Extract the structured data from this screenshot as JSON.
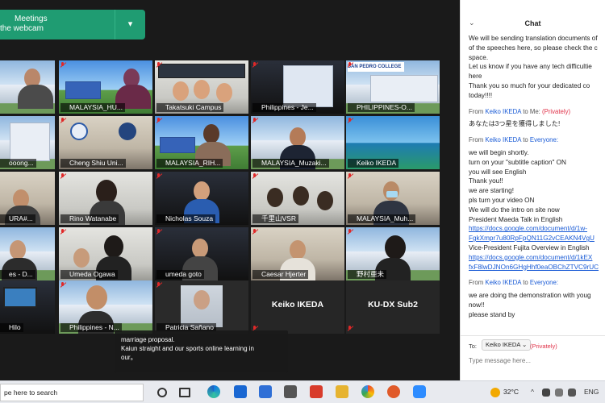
{
  "banner": {
    "line1": "Meetings",
    "line2": "the webcam",
    "chevron": "▾"
  },
  "tiles": [
    {
      "label": ""
    },
    {
      "label": "MALAYSIA_HU..."
    },
    {
      "label": "Takatsuki Campus"
    },
    {
      "label": "Philippines - Je..."
    },
    {
      "label": "PHILIPPINES-O..."
    },
    {
      "label": "ooong..."
    },
    {
      "label": "Cheng Shiu Uni..."
    },
    {
      "label": "MALAYSIA_RIH..."
    },
    {
      "label": "MALAYSIA_Muzaki..."
    },
    {
      "label": "Keiko IKEDA"
    },
    {
      "label": "URA#..."
    },
    {
      "label": "Rino Watanabe"
    },
    {
      "label": "Nicholas Souza"
    },
    {
      "label": "千里山VSR"
    },
    {
      "label": "MALAYSIA_Muh..."
    },
    {
      "label": "es - D..."
    },
    {
      "label": "Umeda   Ogawa"
    },
    {
      "label": "umeda goto"
    },
    {
      "label": "Caesar Hjerter"
    },
    {
      "label": "野村亜未"
    },
    {
      "label": "Hilo"
    },
    {
      "label": "Philippines - N..."
    },
    {
      "label": "Patricia Sañano"
    },
    {
      "label": "",
      "name_only": "Keiko IKEDA"
    },
    {
      "label": "",
      "name_only": "KU-DX Sub2"
    }
  ],
  "tile_text": {
    "san_pedro": "SAN PEDRO COLLEGE",
    "san_pedro2": "SAN PEDRO COLLEGE"
  },
  "caption": {
    "line1": "marriage proposal.",
    "line2": "Kaiun straight and our sports online learning in",
    "line3": "our。"
  },
  "chat": {
    "title": "Chat",
    "chevron": "⌄",
    "intro": [
      "We will be sending translation documents of",
      "of the speeches here, so please check the c",
      "space.",
      "Let us know if you have any tech difficultie",
      "here",
      "Thank you so much for your dedicated co",
      "today!!!!"
    ],
    "msg1": {
      "from": "From",
      "who": "Keiko IKEDA",
      "to": "to Me:",
      "priv": "(Privately)",
      "lines": [
        "あなたは3つ星を獲得しました!"
      ]
    },
    "msg2": {
      "from": "From",
      "who": "Keiko IKEDA",
      "to": "to",
      "whom": "Everyone:",
      "lines": [
        "we will begin shortly.",
        "turn on your \"subtitle caption\" ON",
        "you will see English",
        "Thank you!!",
        "we are starting!",
        "pls turn your video ON",
        "We will do the intro on site now",
        "President Maeda Talk in English"
      ],
      "link1": [
        "https://docs.google.com/document/d/1w-",
        "FgkXmpr7u80RpFpQN11G2vCEAKN4VgU"
      ],
      "mid": [
        "Vice-President Fujita Overview in English"
      ],
      "link2": [
        "https://docs.google.com/document/d/1kEX",
        "fxF8lwDJNOn6GHgHhf0eaOBChZTVC9rUC"
      ]
    },
    "msg3": {
      "from": "From",
      "who": "Keiko IKEDA",
      "to": "to",
      "whom": "Everyone:",
      "lines": [
        "we are doing the demonstration with youg",
        "now!!",
        "please stand by"
      ]
    },
    "footer": {
      "to_label": "To:",
      "to_value": "Keiko IKEDA ⌄",
      "to_priv": "(Privately)",
      "placeholder": "Type message here..."
    }
  },
  "taskbar": {
    "search": "pe here to search",
    "temp": "32°C",
    "lang": "ENG",
    "caret": "^"
  }
}
